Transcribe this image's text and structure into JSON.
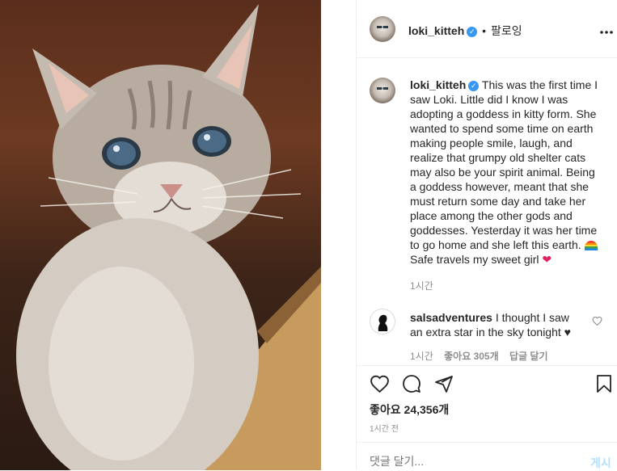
{
  "post": {
    "username": "loki_kitteh",
    "follow_status": "팔로잉",
    "separator": "•",
    "caption": "This was the first time I saw Loki. Little did I know I was adopting a goddess in kitty form. She wanted to spend some time on earth making people smile, laugh, and realize that grumpy old shelter cats may also be your spirit animal. Being a goddess however, meant that she must return some day and take her place among the other gods and goddesses. Yesterday it was her time to go home and she left this earth.",
    "caption_end": "Safe travels my sweet girl",
    "caption_time": "1시간",
    "likes": "좋아요 24,356개",
    "posted_time": "1시간 전"
  },
  "comment": {
    "username": "salsadventures",
    "text": "I thought I saw an extra star in the sky tonight ♥",
    "time": "1시간",
    "likes": "좋아요 305개",
    "reply": "답글 달기"
  },
  "composer": {
    "placeholder": "댓글 달기...",
    "submit": "게시"
  },
  "icons": {
    "verified": "verified-badge-icon",
    "more": "more-options-icon",
    "like": "heart-icon",
    "comment": "comment-icon",
    "share": "share-icon",
    "save": "bookmark-icon"
  },
  "colors": {
    "accent": "#3897f0",
    "muted": "#8e8e8e",
    "text": "#262626"
  }
}
